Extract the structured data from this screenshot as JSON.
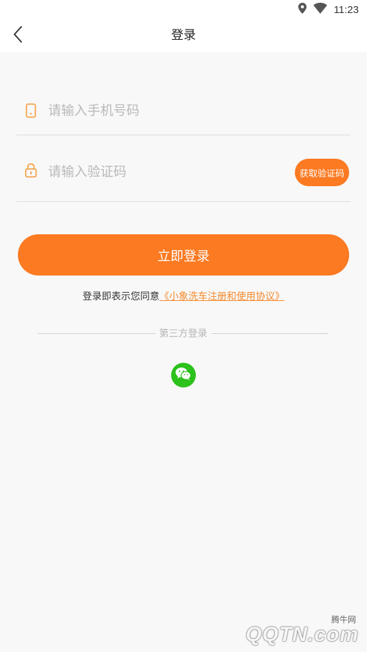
{
  "status_bar": {
    "time": "11:23",
    "icons": [
      "location-icon",
      "wifi-icon"
    ]
  },
  "header": {
    "title": "登录",
    "back_icon": "chevron-left-icon"
  },
  "form": {
    "phone": {
      "placeholder": "请输入手机号码",
      "value": "",
      "icon": "phone-icon"
    },
    "code": {
      "placeholder": "请输入验证码",
      "value": "",
      "icon": "lock-icon",
      "get_code_label": "获取验证码"
    },
    "login_label": "立即登录"
  },
  "agreement": {
    "prefix": "登录即表示您同意",
    "link": "《小象洗车注册和使用协议》"
  },
  "third_party": {
    "label": "第三方登录",
    "providers": [
      "wechat-icon"
    ]
  },
  "watermark": {
    "small": "腾牛网",
    "big": "QQTN.com"
  },
  "colors": {
    "accent": "#fb7a22",
    "link": "#f5882a",
    "wechat": "#2cc11c",
    "background": "#f8f8f8"
  }
}
